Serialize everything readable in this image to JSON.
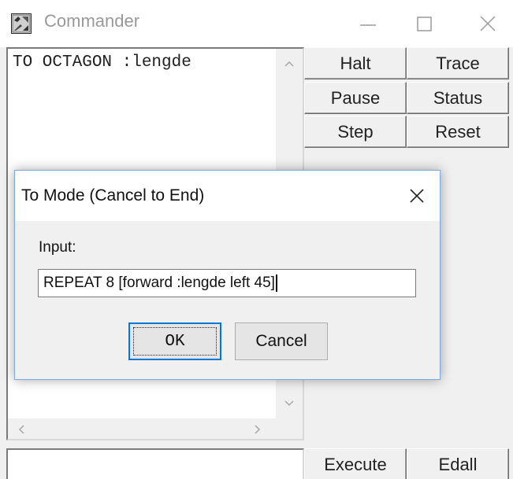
{
  "window": {
    "title": "Commander",
    "icon": "logo-app-icon",
    "controls": {
      "minimize_icon": "minimize-icon",
      "maximize_icon": "maximize-icon",
      "close_icon": "close-icon"
    }
  },
  "editor": {
    "text": "TO OCTAGON :lengde",
    "scroll_up_icon": "chevron-up-icon",
    "scroll_down_icon": "chevron-down-icon",
    "scroll_left_icon": "chevron-left-icon",
    "scroll_right_icon": "chevron-right-icon"
  },
  "buttons": {
    "halt": "Halt",
    "trace": "Trace",
    "pause": "Pause",
    "status": "Status",
    "step": "Step",
    "reset": "Reset",
    "execute": "Execute",
    "edall": "Edall"
  },
  "command_input": {
    "value": ""
  },
  "dialog": {
    "title": "To Mode (Cancel to End)",
    "label": "Input:",
    "input_value": "REPEAT 8 [forward :lengde left 45]",
    "ok_label": "OK",
    "cancel_label": "Cancel",
    "close_icon": "close-icon"
  },
  "colors": {
    "accent": "#0078d7",
    "window_bg": "#f0f0f0",
    "title_text": "#999999"
  }
}
